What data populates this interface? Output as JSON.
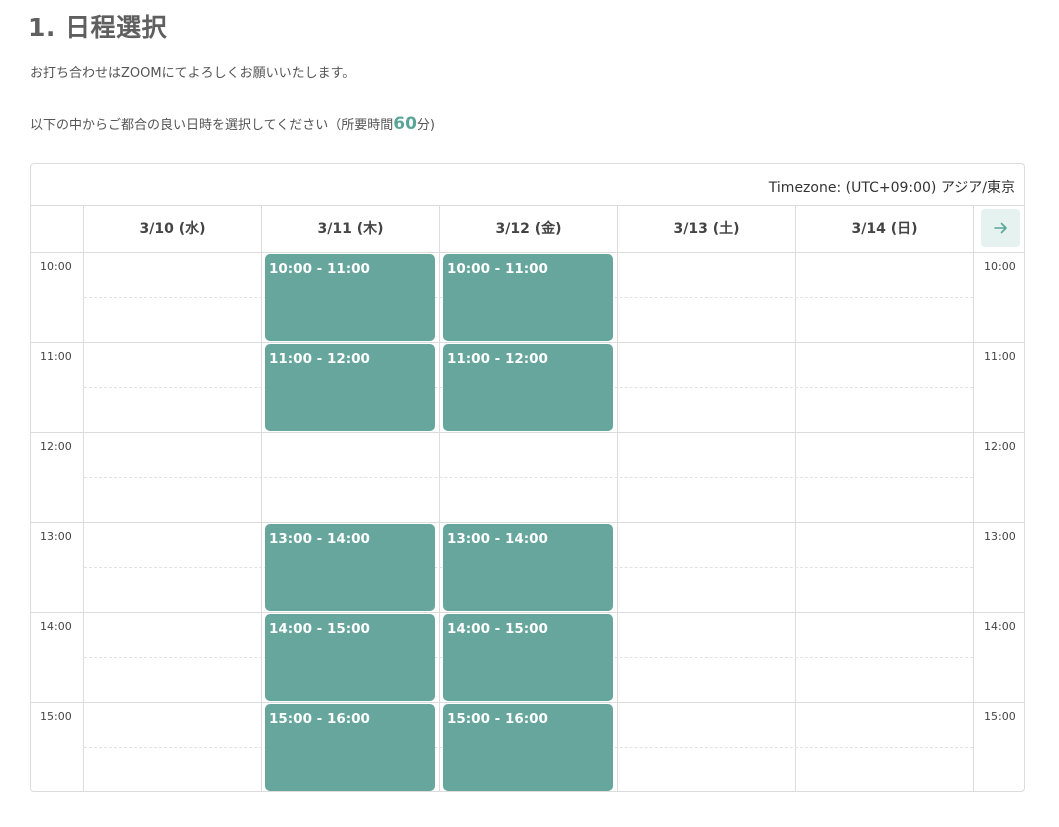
{
  "header": {
    "title": "1. 日程選択",
    "intro": "お打ち合わせはZOOMにてよろしくお願いいたします。",
    "instruction_prefix": "以下の中からご都合の良い日時を選択してください（所要時間",
    "duration_value": "60",
    "instruction_suffix": "分)"
  },
  "calendar": {
    "timezone": "Timezone: (UTC+09:00) アジア/東京",
    "days": [
      "3/10 (水)",
      "3/11 (木)",
      "3/12 (金)",
      "3/13 (土)",
      "3/14 (日)"
    ],
    "hours": [
      "10:00",
      "11:00",
      "12:00",
      "13:00",
      "14:00",
      "15:00"
    ],
    "next_icon": "arrow-right-icon",
    "slots": {
      "day2": [
        "10:00 - 11:00",
        "11:00 - 12:00",
        "13:00 - 14:00",
        "14:00 - 15:00",
        "15:00 - 16:00"
      ],
      "day3": [
        "10:00 - 11:00",
        "11:00 - 12:00",
        "13:00 - 14:00",
        "14:00 - 15:00",
        "15:00 - 16:00"
      ]
    }
  },
  "colors": {
    "accent": "#66a69c",
    "nav_button_bg": "#e5f2ef",
    "duration_text": "#5aa598"
  }
}
